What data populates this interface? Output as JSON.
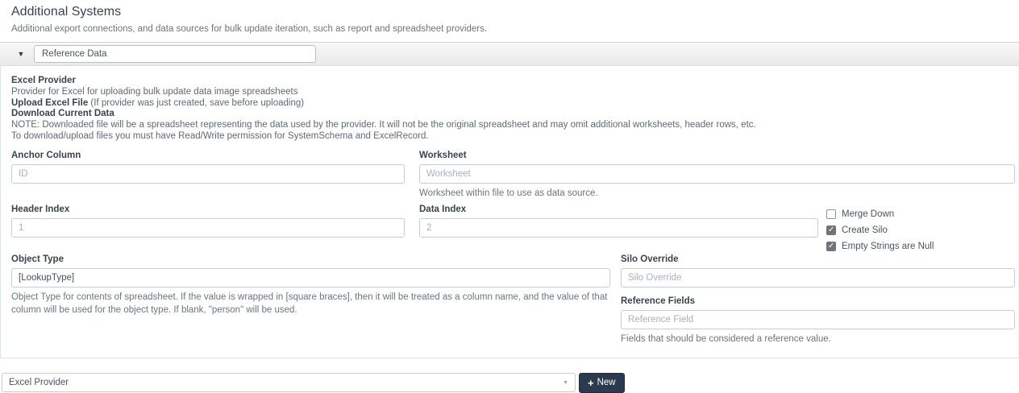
{
  "page": {
    "title": "Additional Systems",
    "subtitle": "Additional export connections, and data sources for bulk update iteration, such as report and spreadsheet providers."
  },
  "panel": {
    "collapse_icon": "▼",
    "name_value": "Reference Data",
    "description": {
      "heading": "Excel Provider",
      "provider_line": "Provider for Excel for uploading bulk update data image spreadsheets",
      "upload_link": "Upload Excel File",
      "upload_note": " (If provider was just created, save before uploading)",
      "download_link": "Download Current Data",
      "note_line": "NOTE: Downloaded file will be a spreadsheet representing the data used by the provider. It will not be the original spreadsheet and may omit additional worksheets, header rows, etc.",
      "permission_line": "To download/upload files you must have Read/Write permission for SystemSchema and ExcelRecord."
    },
    "fields": {
      "anchor_column": {
        "label": "Anchor Column",
        "placeholder": "ID"
      },
      "worksheet": {
        "label": "Worksheet",
        "placeholder": "Worksheet",
        "help": "Worksheet within file to use as data source."
      },
      "header_index": {
        "label": "Header Index",
        "placeholder": "1"
      },
      "data_index": {
        "label": "Data Index",
        "placeholder": "2"
      },
      "object_type": {
        "label": "Object Type",
        "value": "[LookupType]",
        "help": "Object Type for contents of spreadsheet. If the value is wrapped in [square braces], then it will be treated as a column name, and the value of that column will be used for the object type. If blank, \"person\" will be used."
      },
      "silo_override": {
        "label": "Silo Override",
        "placeholder": "Silo Override"
      },
      "reference_fields": {
        "label": "Reference Fields",
        "placeholder": "Reference Field",
        "help": "Fields that should be considered a reference value."
      }
    },
    "checkboxes": [
      {
        "label": "Merge Down",
        "checked": false
      },
      {
        "label": "Create Silo",
        "checked": true
      },
      {
        "label": "Empty Strings are Null",
        "checked": true
      }
    ]
  },
  "footer": {
    "provider_select_value": "Excel Provider",
    "select_caret": "▼",
    "new_button_plus": "+",
    "new_button_label": "New"
  },
  "colors": {
    "accent_button": "#2b3a4f",
    "panel_header_bg": "#e9e9e9",
    "checked_checkbox": "#6e747a",
    "label_text": "#39434e",
    "muted_text": "#6c757d"
  }
}
